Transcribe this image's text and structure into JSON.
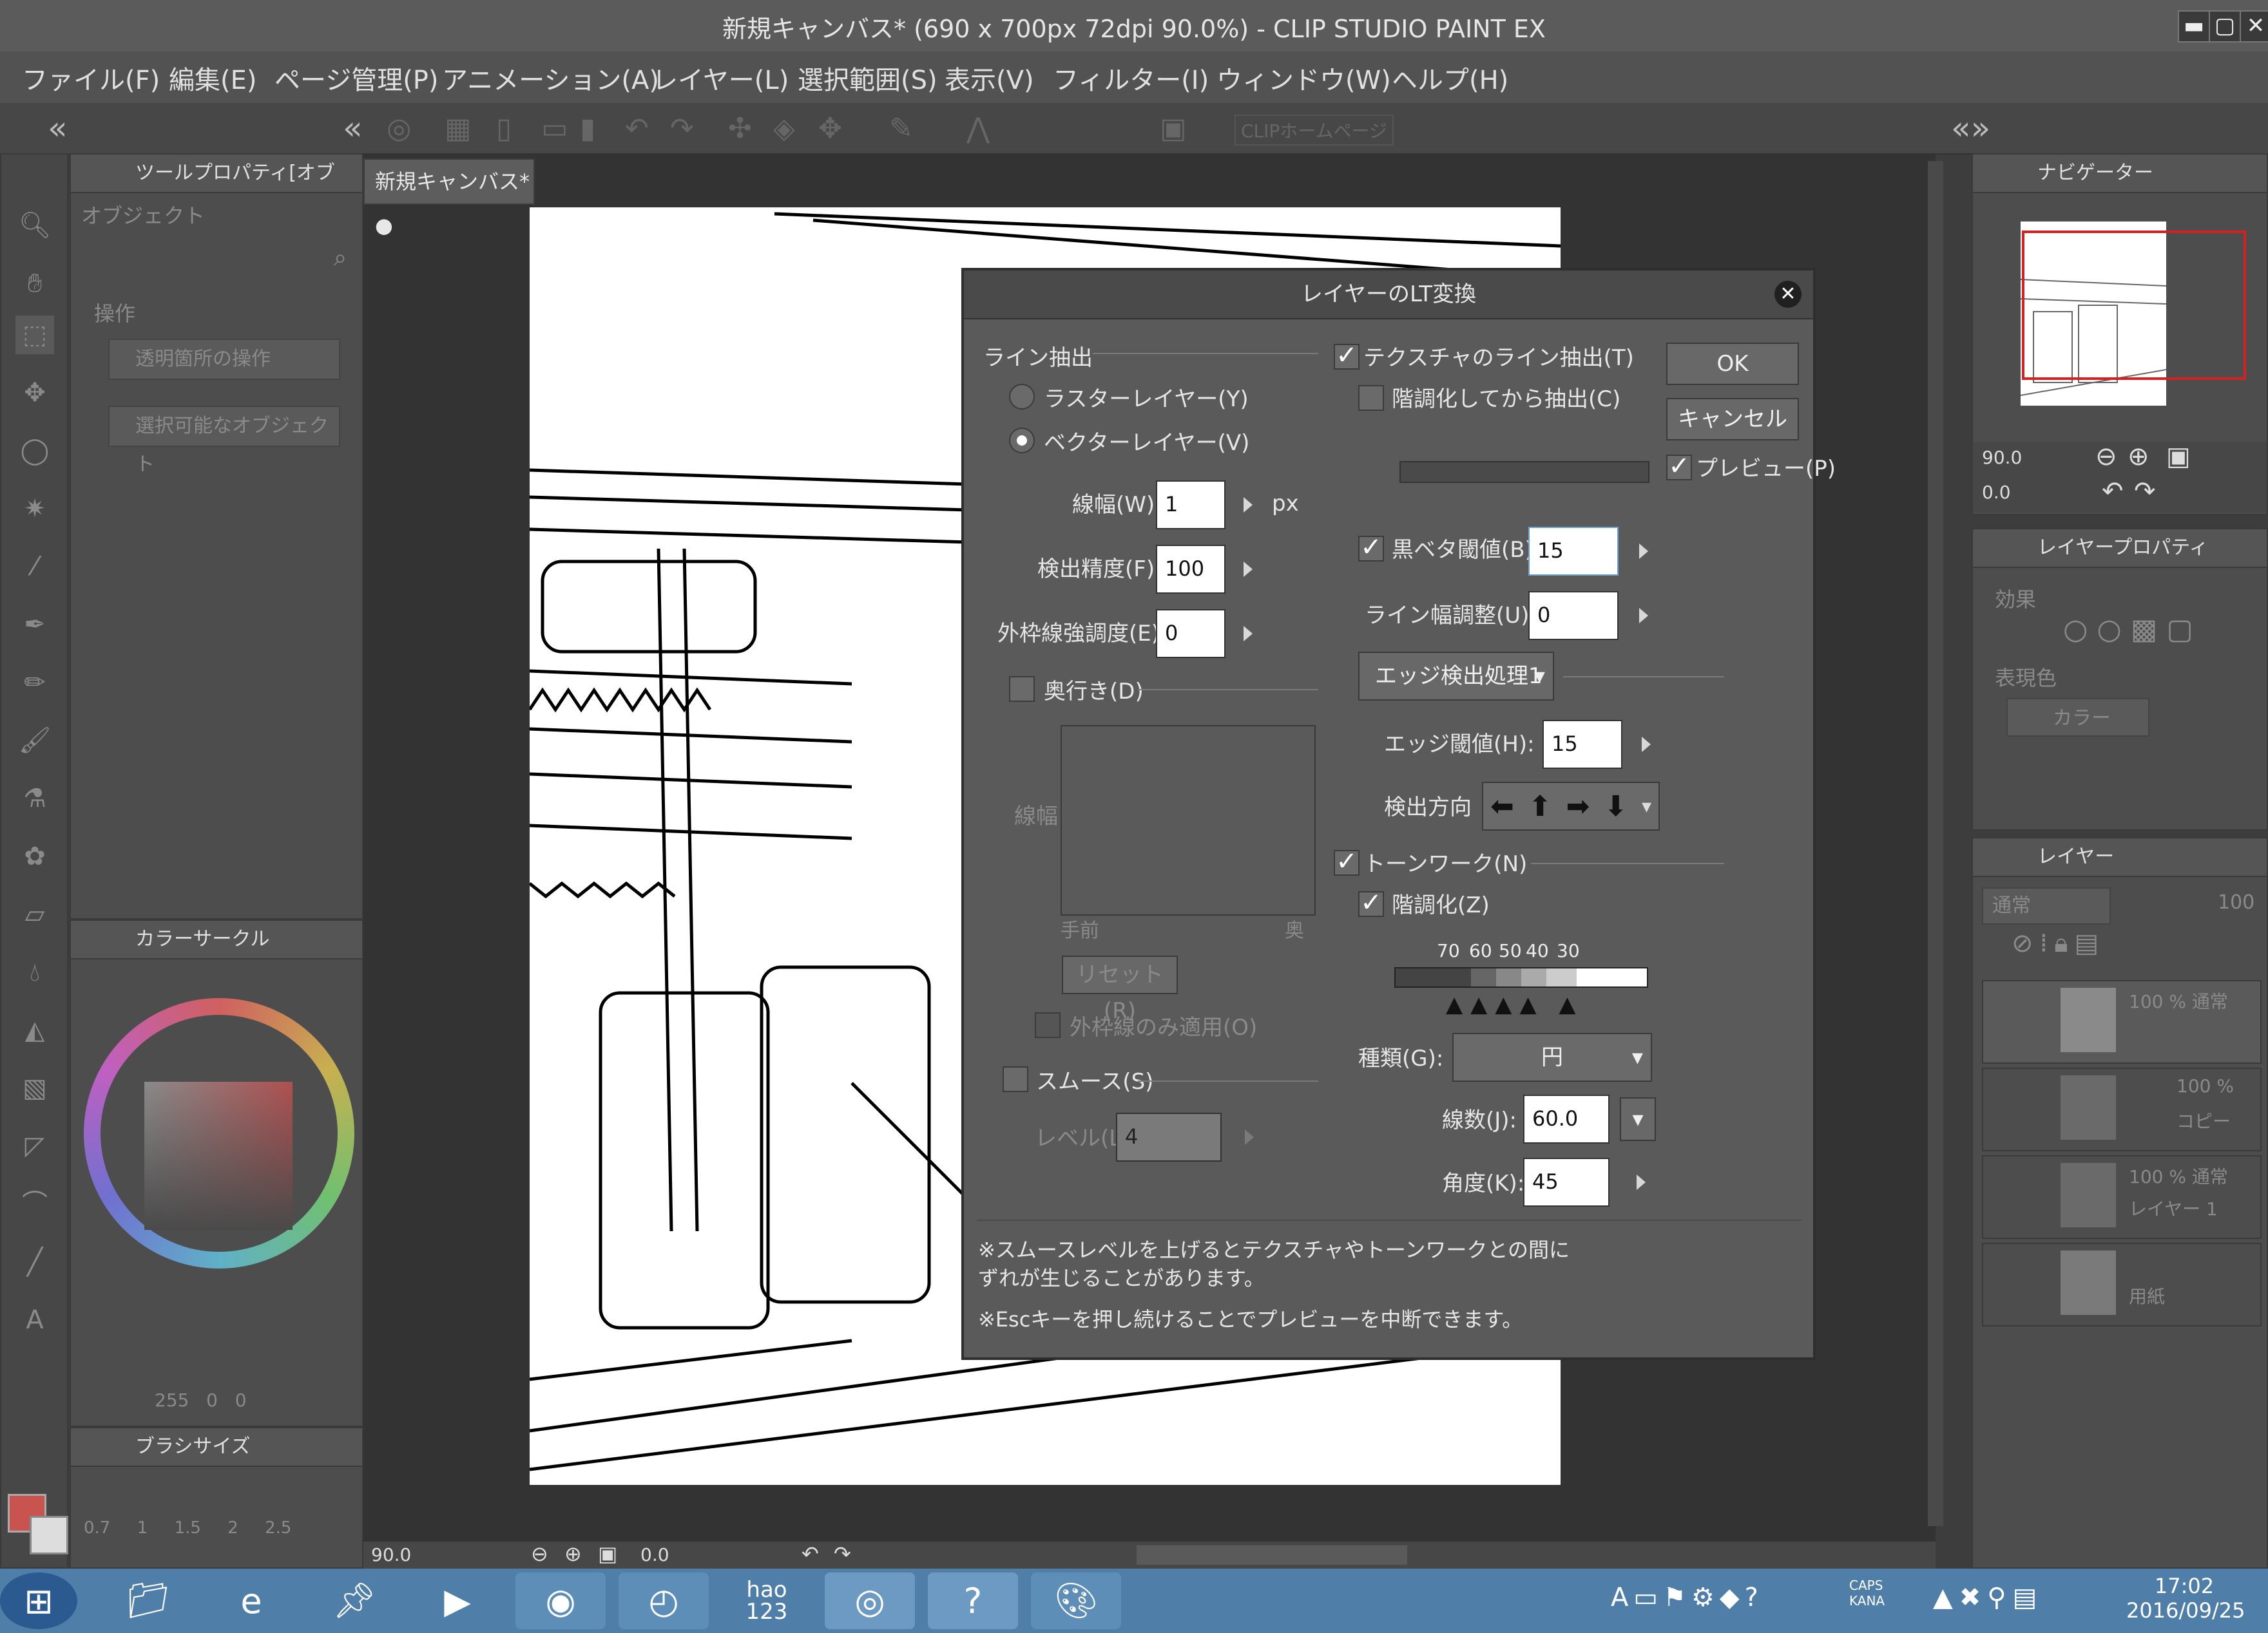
{
  "app": {
    "title": "新規キャンバス* (690 x 700px 72dpi 90.0%)  - CLIP STUDIO PAINT EX",
    "window_min": "▬",
    "window_max": "▢",
    "window_close": "✕"
  },
  "menubar": {
    "items": [
      "ファイル(F)",
      "編集(E)",
      "ページ管理(P)",
      "アニメーション(A)",
      "レイヤー(L)",
      "選択範囲(S)",
      "表示(V)",
      "フィルター(I)",
      "ウィンドウ(W)",
      "ヘルプ(H)"
    ]
  },
  "command_bar": {
    "clip_label": "CLIPホームページ"
  },
  "tool_property": {
    "tab_label": "ツールプロパティ[オブ",
    "object_label": "オブジェクト",
    "operation_label": "操作",
    "transparent_op": "透明箇所の操作",
    "selectable_obj": "選択可能なオブジェクト"
  },
  "color_circle": {
    "tab_label": "カラーサークル",
    "r_value": "255",
    "g_value": "0",
    "b_value": "0"
  },
  "brush_size": {
    "tab_label": "ブラシサイズ",
    "sizes": [
      "0.7",
      "1",
      "1.5",
      "2",
      "2.5"
    ]
  },
  "canvas": {
    "tab_label": "新規キャンバス*",
    "zoom": "90.0",
    "angle": "0.0"
  },
  "dialog": {
    "title": "レイヤーのLT変換",
    "close": "✕",
    "line_extract": "ライン抽出",
    "raster_layer": "ラスターレイヤー(Y)",
    "vector_layer": "ベクターレイヤー(V)",
    "line_width_label": "線幅(W):",
    "line_width": "1",
    "line_width_unit": "px",
    "detect_precision_label": "検出精度(F):",
    "detect_precision": "100",
    "outline_strength_label": "外枠線強調度(E):",
    "outline_strength": "0",
    "depth_label": "奥行き(D)",
    "depth_line_width": "線幅",
    "depth_near": "手前",
    "depth_far": "奥",
    "reset_btn": "リセット(R)",
    "outline_only": "外枠線のみ適用(O)",
    "smooth_label": "スムース(S)",
    "level_label": "レベル(L):",
    "level": "4",
    "texture_line": "テクスチャのライン抽出(T)",
    "gradation_extract": "階調化してから抽出(C)",
    "black_threshold_label": "黒ベタ閾値(B):",
    "black_threshold": "15",
    "line_width_adjust_label": "ライン幅調整(U):",
    "line_width_adjust": "0",
    "edge_process": "エッジ検出処理1",
    "edge_threshold_label": "エッジ閾値(H):",
    "edge_threshold": "15",
    "detect_dir_label": "検出方向",
    "tone_work": "トーンワーク(N)",
    "gradation": "階調化(Z)",
    "grad_values": [
      "70",
      "60",
      "50",
      "40",
      "30"
    ],
    "kind_label": "種類(G):",
    "kind": "円",
    "lines_label": "線数(J):",
    "lines": "60.0",
    "angle_label": "角度(K):",
    "angle": "45",
    "ok_btn": "OK",
    "cancel_btn": "キャンセル",
    "preview": "プレビュー(P)",
    "note1": "※スムースレベルを上げるとテクスチャやトーンワークとの間に",
    "note2": "ずれが生じることがあります。",
    "note3": "※Escキーを押し続けることでプレビューを中断できます。"
  },
  "navigator": {
    "tab_label": "ナビゲーター",
    "zoom": "90.0",
    "angle": "0.0"
  },
  "layer_property": {
    "tab_label": "レイヤープロパティ",
    "effect_label": "効果",
    "color_label": "表現色",
    "color_value": "カラー"
  },
  "layers": {
    "tab_label": "レイヤー",
    "blend": "通常",
    "opacity": "100",
    "items": [
      {
        "info": "100 % 通常",
        "name": ""
      },
      {
        "info": "100 %",
        "name": "コピー"
      },
      {
        "info": "100 % 通常",
        "name": "レイヤー 1"
      },
      {
        "info": "",
        "name": "用紙"
      }
    ]
  },
  "taskbar": {
    "time": "17:02",
    "date": "2016/09/25",
    "caps": "CAPS",
    "kana": "KANA",
    "hao_line1": "hao",
    "hao_line2": "123"
  },
  "colors": {
    "accent_red": "#d32020",
    "main_color": "#c9534f",
    "taskbar": "#4f7fa8"
  }
}
